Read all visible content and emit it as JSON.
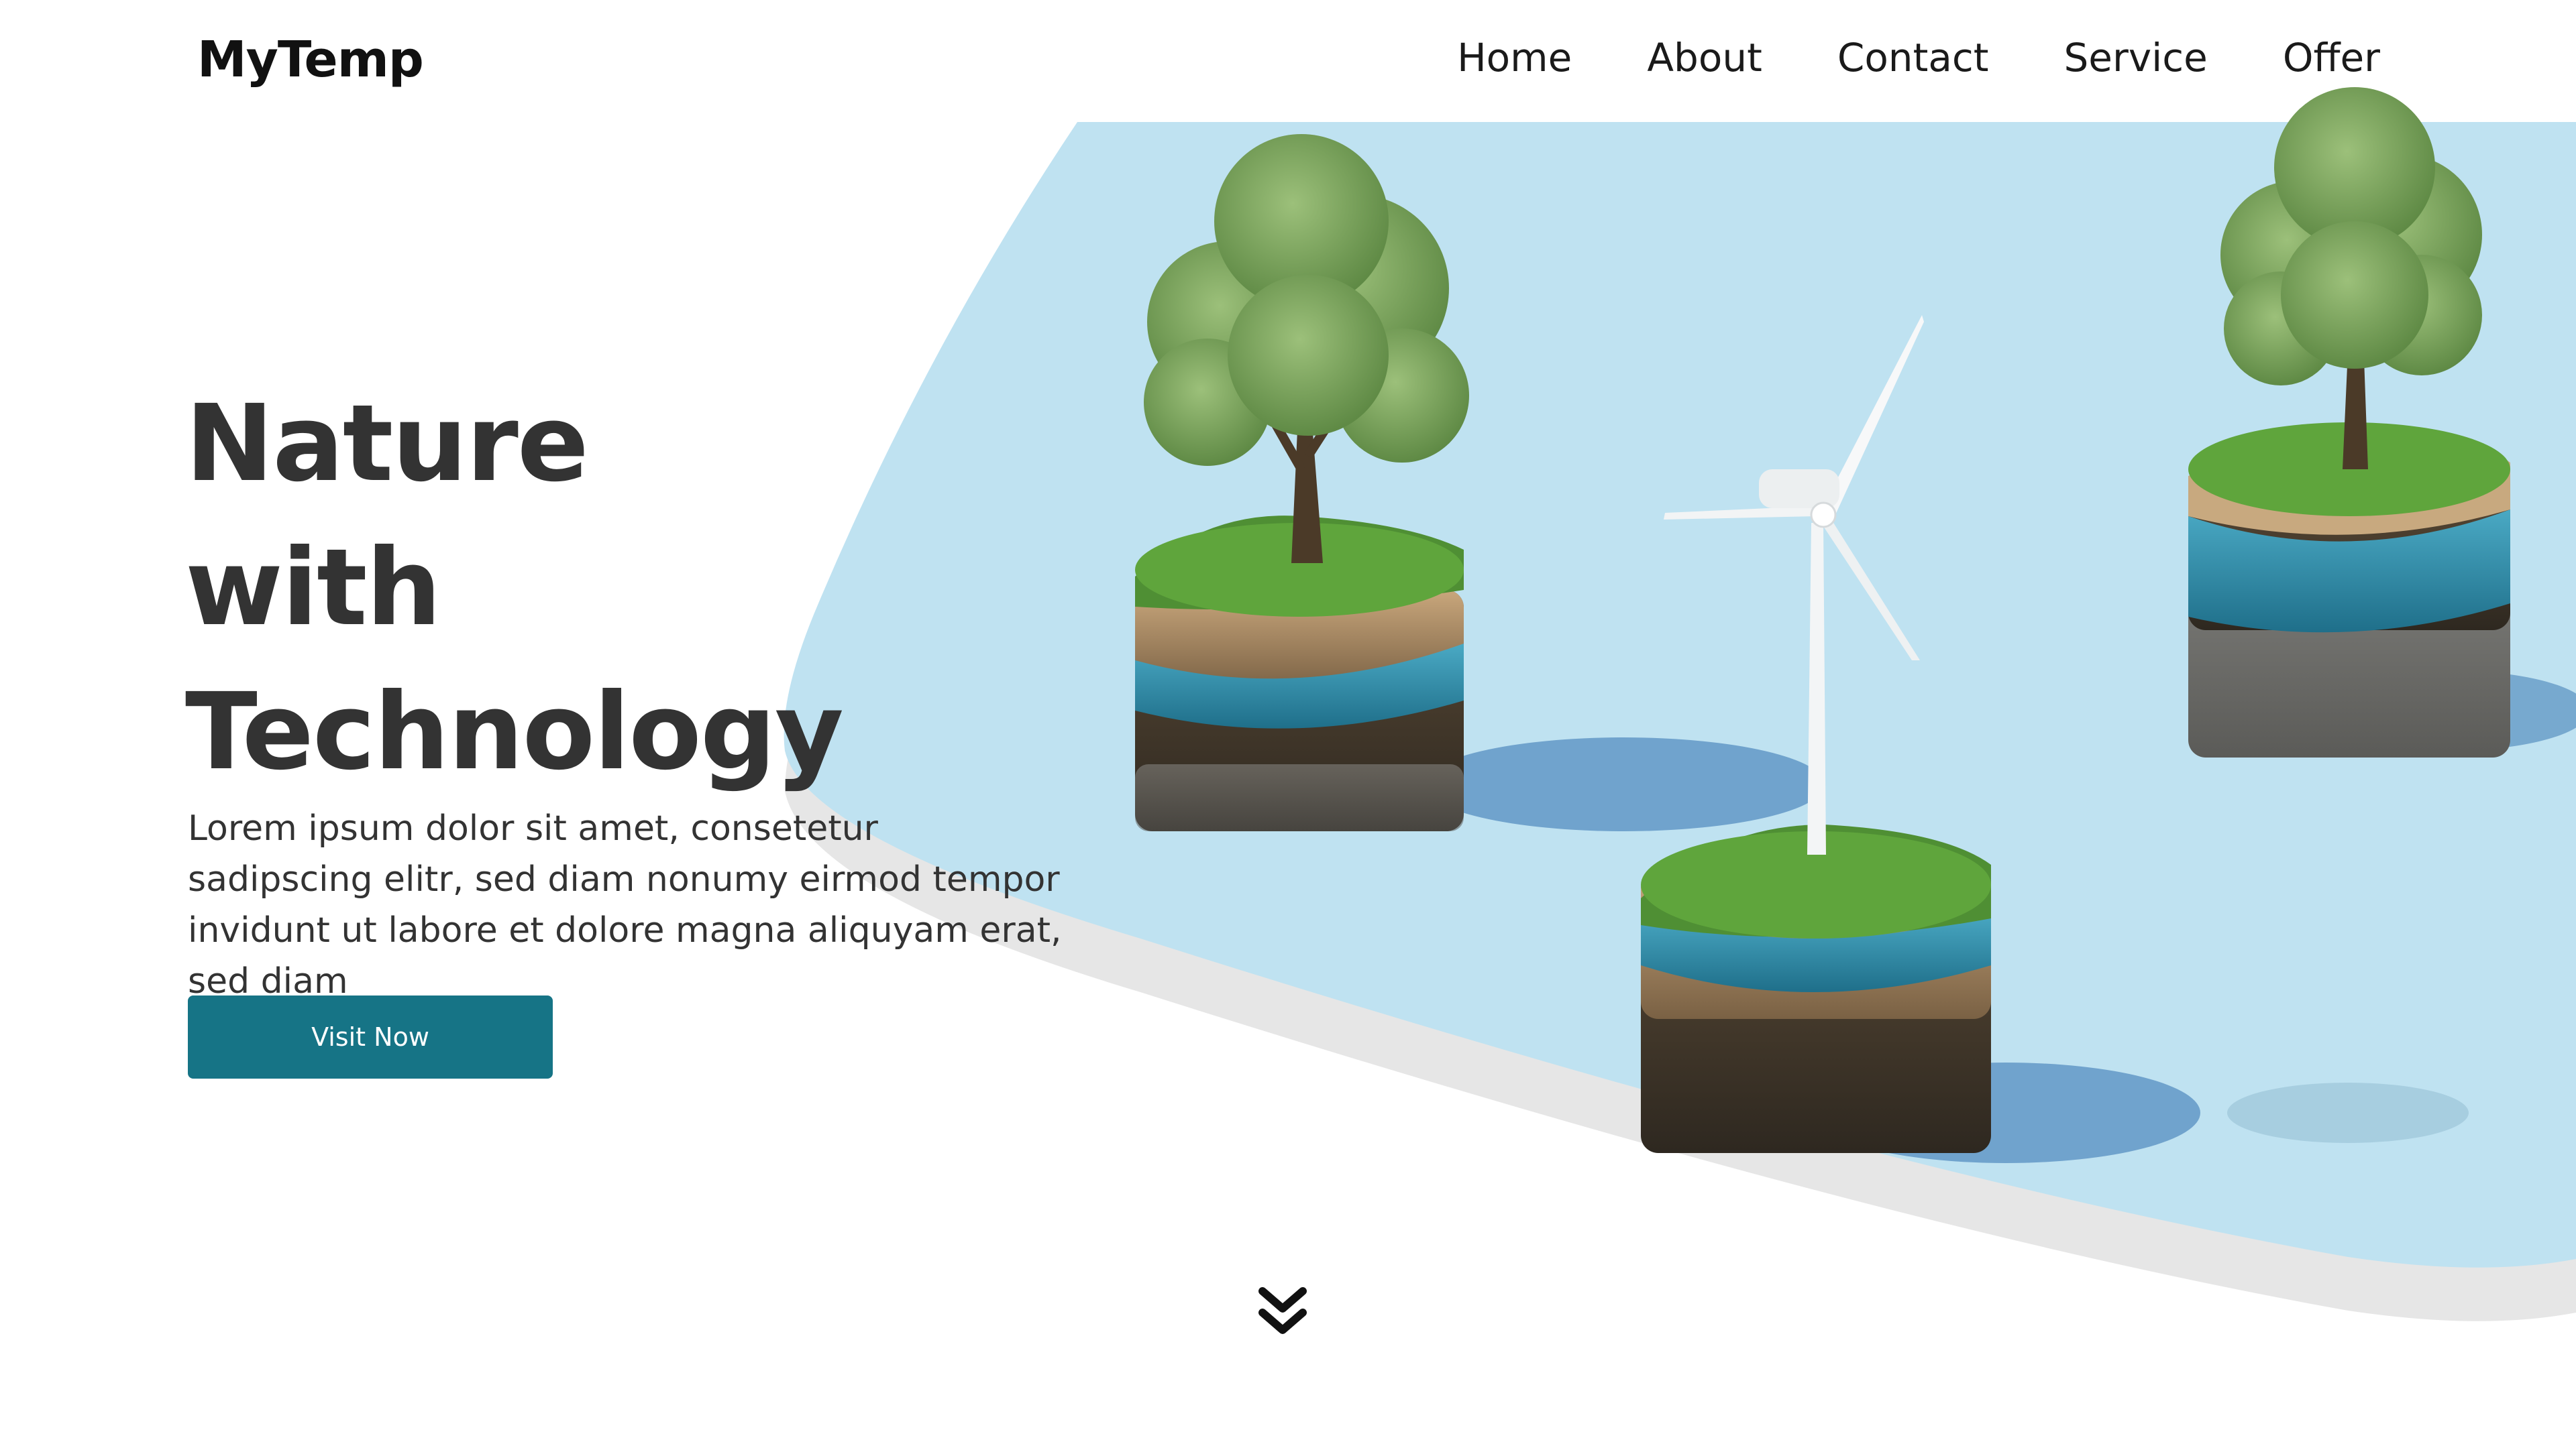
{
  "brand": {
    "logo_text": "MyTemp"
  },
  "nav": {
    "items": [
      {
        "label": "Home"
      },
      {
        "label": "About"
      },
      {
        "label": "Contact"
      },
      {
        "label": "Service"
      },
      {
        "label": "Offer"
      }
    ]
  },
  "hero": {
    "title_lines": [
      "Nature",
      "with",
      "Technology"
    ],
    "description": "Lorem ipsum dolor sit amet, consetetur sadipscing elitr, sed diam nonumy eirmod tempor invidunt ut labore et dolore magna aliquyam erat, sed diam",
    "cta_label": "Visit Now"
  },
  "icons": {
    "scroll": "double-chevron-down-icon",
    "illustration": "nature-technology-illustration"
  },
  "colors": {
    "accent": "#167486",
    "hero_background": "#bfe2f1",
    "hero_shadow": "#e6e6e6",
    "text_dark": "#333333"
  }
}
